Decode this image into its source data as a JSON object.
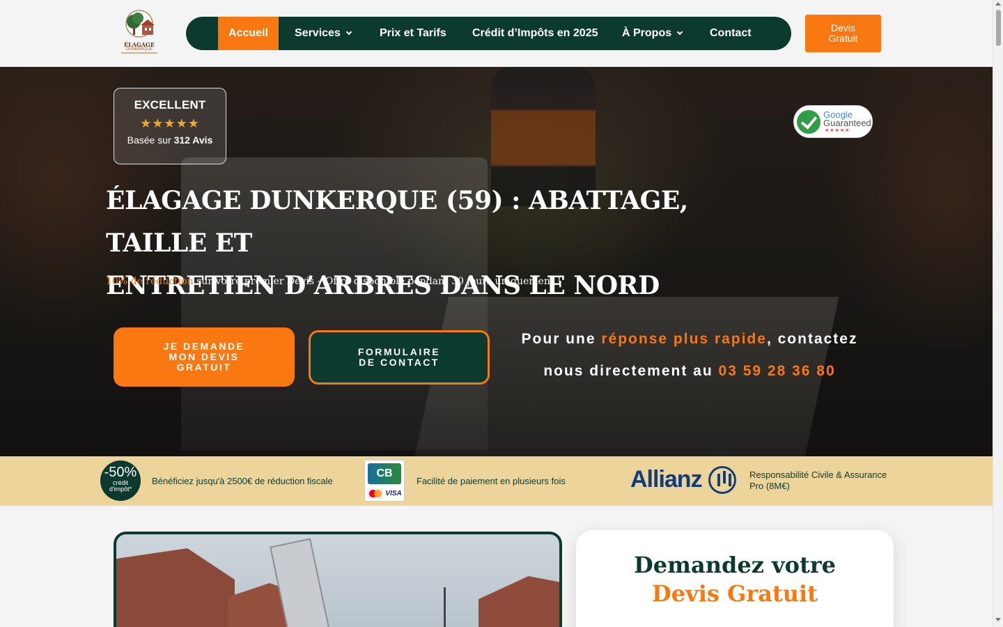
{
  "logo": {
    "line1": "ÉLAGAGE",
    "line2": "DUNKERQUE"
  },
  "nav": {
    "items": [
      {
        "label": "Accueil",
        "active": true,
        "has_dropdown": false
      },
      {
        "label": "Services",
        "active": false,
        "has_dropdown": true
      },
      {
        "label": "Prix et Tarifs",
        "active": false,
        "has_dropdown": false
      },
      {
        "label": "Crédit d’Impôts en 2025",
        "active": false,
        "has_dropdown": false
      },
      {
        "label": "À Propos",
        "active": false,
        "has_dropdown": true
      },
      {
        "label": "Contact",
        "active": false,
        "has_dropdown": false
      }
    ],
    "cta_line1": "Devis",
    "cta_line2": "Gratuit"
  },
  "hero": {
    "rating_title": "EXCELLENT",
    "stars": "★★★★★",
    "rating_prefix": "Basée sur",
    "rating_count": "312 Avis",
    "badge_google": "Google",
    "badge_guaranteed": "Guaranteed",
    "badge_stars": "★★★★★",
    "title_line1": "ÉLAGAGE DUNKERQUE (59) : ABATTAGE, TAILLE ET",
    "title_line2": "ENTRETIEN D’ARBRES DANS LE NORD",
    "promo_highlight": "10% de réduction",
    "promo_rest": " sur votre premier Devis – Offre disponible pendant 30 jours uniquement !",
    "btn_devis_line1": "JE DEMANDE",
    "btn_devis_line2": "MON DEVIS",
    "btn_devis_line3": "GRATUIT",
    "btn_contact_line1": "FORMULAIRE",
    "btn_contact_line2": "DE CONTACT",
    "contact_pre": "Pour une ",
    "contact_highlight": "réponse plus rapide",
    "contact_mid": ", contactez",
    "contact_line2_pre": "nous directement au ",
    "phone": "03 59 28 36 80"
  },
  "strip": {
    "badge_big": "-50%",
    "badge_small1": "crédit",
    "badge_small2": "d'impôt*",
    "text1": "Bénéficiez jusqu'à 2500€ de réduction fiscale",
    "cb_label": "CB",
    "visa_label": "VISA",
    "text2": "Facilité de paiement en plusieurs fois",
    "allianz": "Allianz",
    "text3_line1": "Responsabilité Civile & Assurance",
    "text3_line2": "Pro (8M€)"
  },
  "form": {
    "title_line1": "Demandez votre",
    "title_line2": "Devis Gratuit"
  },
  "colors": {
    "brand_green": "#0d3a2f",
    "brand_orange": "#f97811",
    "strip_bg": "#ecd49a"
  }
}
